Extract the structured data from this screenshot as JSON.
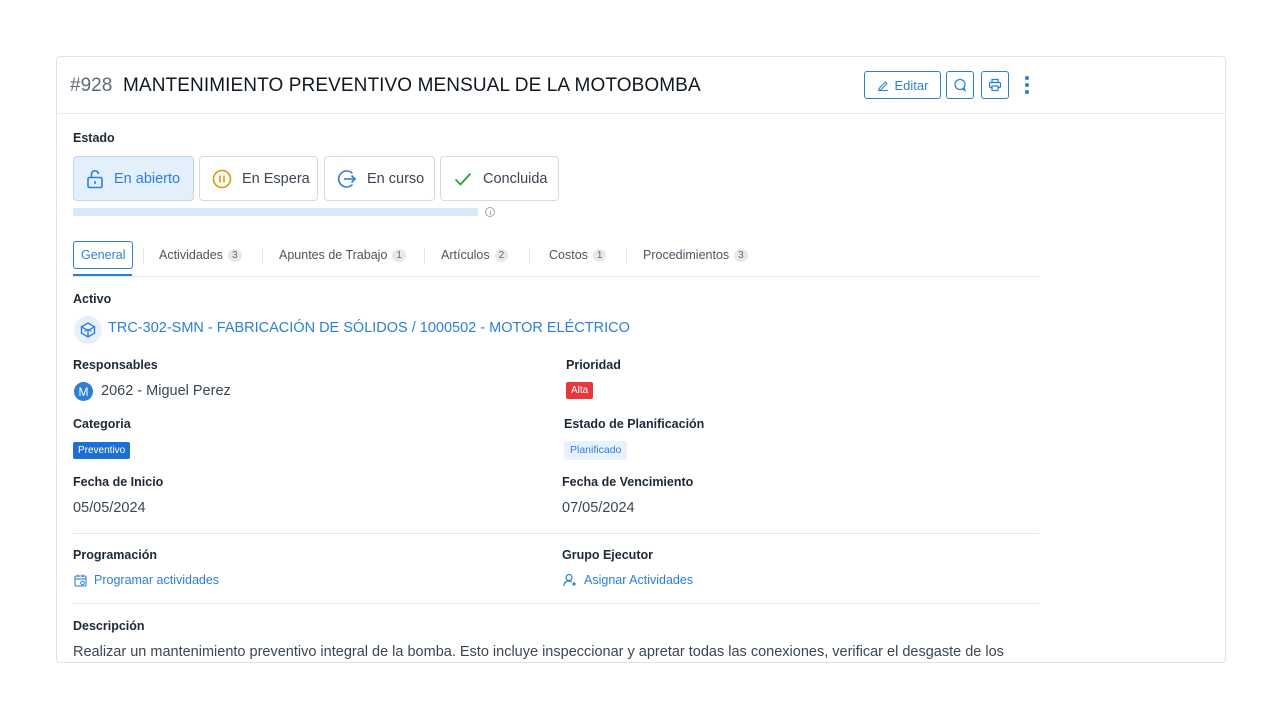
{
  "header": {
    "number": "#928",
    "title": "MANTENIMIENTO PREVENTIVO MENSUAL DE LA MOTOBOMBA",
    "edit_label": "Editar"
  },
  "estado": {
    "label": "Estado",
    "options": [
      {
        "label": "En abierto",
        "icon": "unlock-icon",
        "active": true
      },
      {
        "label": "En Espera",
        "icon": "pause-circle-icon",
        "active": false
      },
      {
        "label": "En curso",
        "icon": "arrow-right-circle-icon",
        "active": false
      },
      {
        "label": "Concluida",
        "icon": "check-icon",
        "active": false
      }
    ],
    "progress": 1.0
  },
  "tabs": [
    {
      "label": "General",
      "count": null,
      "active": true
    },
    {
      "label": "Actividades",
      "count": "3"
    },
    {
      "label": "Apuntes de Trabajo",
      "count": "1"
    },
    {
      "label": "Artículos",
      "count": "2"
    },
    {
      "label": "Costos",
      "count": "1"
    },
    {
      "label": "Procedimientos",
      "count": "3"
    }
  ],
  "general": {
    "activo_label": "Activo",
    "activo_value": "TRC-302-SMN - FABRICACIÓN DE SÓLIDOS / 1000502 - MOTOR ELÉCTRICO",
    "responsables_label": "Responsables",
    "responsable_initial": "M",
    "responsable_value": "2062 - Miguel Perez",
    "prioridad_label": "Prioridad",
    "prioridad_value": "Alta",
    "categoria_label": "Categoria",
    "categoria_value": "Preventivo",
    "planificacion_label": "Estado de Planificación",
    "planificacion_value": "Planificado",
    "fecha_inicio_label": "Fecha de Inicio",
    "fecha_inicio_value": "05/05/2024",
    "fecha_venc_label": "Fecha de Vencimiento",
    "fecha_venc_value": "07/05/2024",
    "programacion_label": "Programación",
    "programacion_action": "Programar actividades",
    "grupo_label": "Grupo Ejecutor",
    "grupo_action": "Asignar Actividades",
    "descripcion_label": "Descripción",
    "descripcion_value": "Realizar un mantenimiento preventivo integral de la bomba. Esto incluye inspeccionar y apretar todas las conexiones, verificar el desgaste de los"
  },
  "colors": {
    "accent": "#2b7fd6",
    "priority_high": "#e5373d",
    "category": "#1d6fd1"
  }
}
